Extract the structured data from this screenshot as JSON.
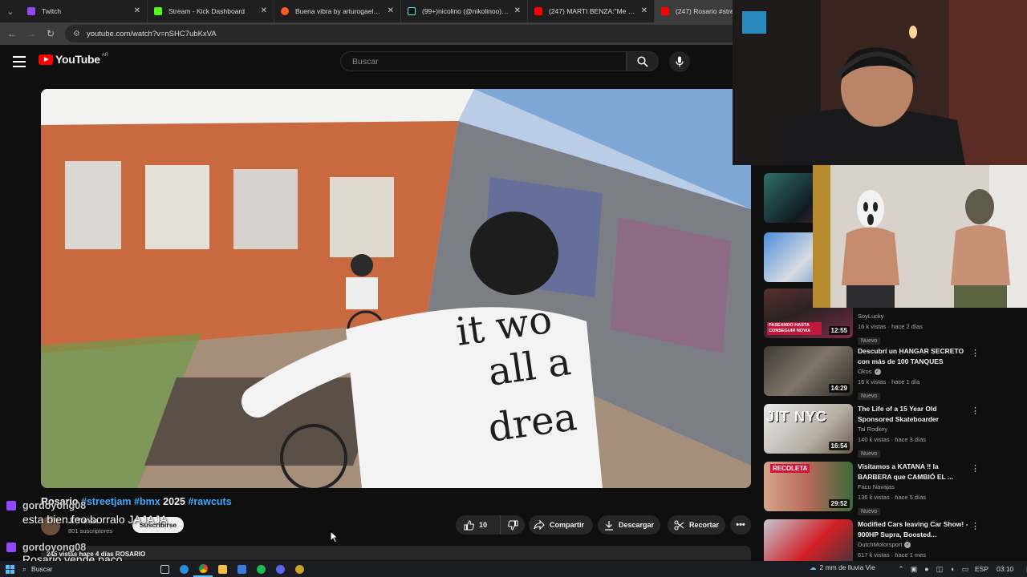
{
  "browser": {
    "tabs": [
      {
        "title": "Twitch",
        "favicon_color": "#9146ff",
        "active": false
      },
      {
        "title": "Stream - Kick Dashboard",
        "favicon_color": "#53fc18",
        "active": false
      },
      {
        "title": "Buena vibra by arturogaeldelec",
        "favicon_color": "#ff5722",
        "active": false
      },
      {
        "title": "(99+)nicolino (@nikolinoo) | Ti",
        "favicon_color": "#111111",
        "active": false
      },
      {
        "title": "(247) MARTI BENZA:\"Me quedé",
        "favicon_color": "#ff0000",
        "active": false
      },
      {
        "title": "(247) Rosario #streetjam",
        "favicon_color": "#ff0000",
        "active": true
      }
    ],
    "url": "youtube.com/watch?v=nSHC7ubKxVA"
  },
  "youtube": {
    "logo_text": "YouTube",
    "country": "AR",
    "search_placeholder": "Buscar"
  },
  "video": {
    "title_plain_1": "Rosario ",
    "tag_1": "#streetjam",
    "tag_2": "#bmx",
    "title_plain_2": " 2025 ",
    "tag_3": "#rawcuts",
    "channel_name": "J. Tuñez",
    "subscribers": "801 suscriptores",
    "subscribe_label": "Suscribirse",
    "likes": "10",
    "share_label": "Compartir",
    "download_label": "Descargar",
    "clip_label": "Recortar",
    "stats": "245 vistas  hace 4 días  ROSARIO"
  },
  "related": [
    {
      "title": "",
      "channel": "SoyLucky",
      "stats": "16 k vistas · hace 2 días",
      "badge": "Nuevo",
      "duration": "12:55",
      "thumb_text": "PASEANDO HASTA CONSEGUIR NOVIA",
      "verified": false
    },
    {
      "title": "Descubrí un HANGAR SECRETO con más de 100 TANQUES",
      "channel": "Okos",
      "stats": "16 k vistas · hace 1 día",
      "badge": "Nuevo",
      "duration": "14:29",
      "thumb_text": "",
      "verified": true
    },
    {
      "title": "The Life of a 15 Year Old Sponsored Skateboarder",
      "channel": "Tal Rodkey",
      "stats": "140 k vistas · hace 3 días",
      "badge": "Nuevo",
      "duration": "16:54",
      "thumb_text": "JIT NYC",
      "verified": false
    },
    {
      "title": "Visitamos a KATANA ‼ la BARBERA que CAMBIÓ EL ...",
      "channel": "Facu Navajas",
      "stats": "136 k vistas · hace 5 días",
      "badge": "Nuevo",
      "duration": "29:52",
      "thumb_text": "RECOLETA",
      "verified": false
    },
    {
      "title": "Modified Cars leaving Car Show! - 900HP Supra, Boosted...",
      "channel": "DutchMotorsport",
      "stats": "617 k vistas · hace 1 mes",
      "badge": "",
      "duration": "",
      "thumb_text": "",
      "verified": true
    }
  ],
  "chat": [
    {
      "user": "gordoyong08",
      "message": "esta bien feo borralo JAJAJA"
    },
    {
      "user": "gordoyong08",
      "message": "Rosario vende paco"
    }
  ],
  "taskbar": {
    "search_placeholder": "Buscar",
    "weather": "2 mm de lluvia  Vie",
    "language": "ESP",
    "time": "03:10"
  }
}
